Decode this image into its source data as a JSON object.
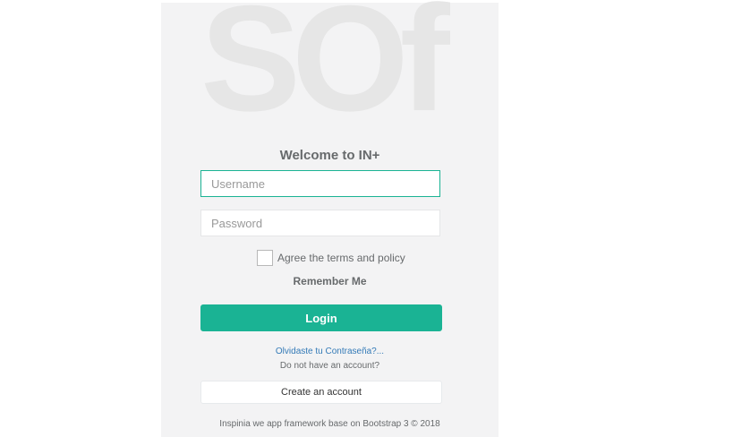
{
  "logo": {
    "text": "SOf"
  },
  "welcome": {
    "title": "Welcome to IN+"
  },
  "form": {
    "username": {
      "placeholder": "Username",
      "value": ""
    },
    "password": {
      "placeholder": "Password",
      "value": ""
    },
    "terms_label": "Agree the terms and policy",
    "terms_checked": false,
    "remember_label": "Remember Me",
    "login_label": "Login"
  },
  "links": {
    "forgot": "Olvidaste tu Contraseña?...",
    "no_account": "Do not have an account?",
    "create_account": "Create an account"
  },
  "footer": {
    "text": "Inspinia we app framework base on Bootstrap 3 © 2018"
  },
  "colors": {
    "accent": "#1ab394",
    "link": "#337ab7",
    "panel_bg": "#f3f3f4",
    "logo": "#e6e6e6"
  }
}
